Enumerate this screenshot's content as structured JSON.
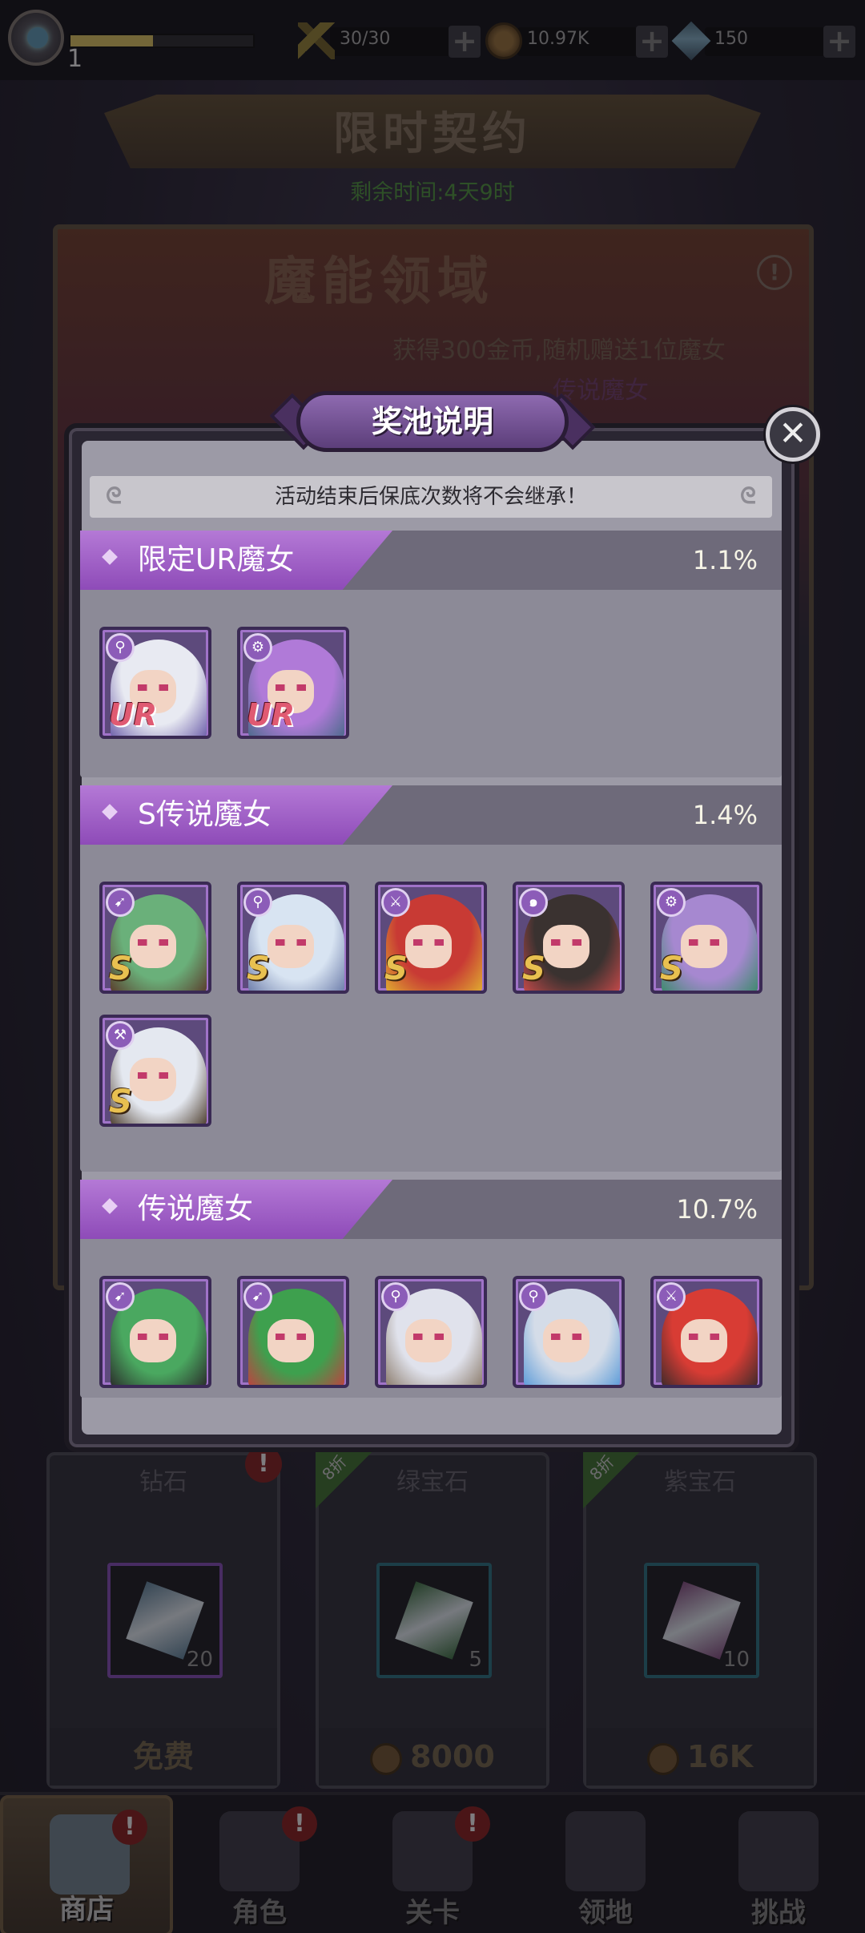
{
  "topbar": {
    "level": "1",
    "xp_fraction": 0.45,
    "stamina": "30/30",
    "gold": "10.97K",
    "diamonds": "150",
    "plus_symbol": "+"
  },
  "event": {
    "banner_title": "限时契约",
    "timer": "剩余时间:4天9时",
    "name": "魔能领域",
    "info_symbol": "!",
    "desc_line1": "获得300金币,随机赠送1位魔女",
    "desc_line2": "传说魔女"
  },
  "modal": {
    "title": "奖池说明",
    "close_symbol": "✕",
    "notice": "活动结束后保底次数将不会继承！",
    "swirl_symbol": "ᘓ",
    "sections": [
      {
        "title": "限定UR魔女",
        "rate": "1.1%",
        "characters": [
          {
            "rank": "UR",
            "class_icon": "staff-icon",
            "hair": "#e8eaf2",
            "accent": "#6a5ca8"
          },
          {
            "rank": "UR",
            "class_icon": "gear-icon",
            "hair": "#b07ad8",
            "accent": "#4a6a8a"
          }
        ]
      },
      {
        "title": "S传说魔女",
        "rate": "1.4%",
        "characters": [
          {
            "rank": "S",
            "class_icon": "gun-icon",
            "hair": "#6ab07a",
            "accent": "#5a3a2a"
          },
          {
            "rank": "S",
            "class_icon": "staff-icon",
            "hair": "#d8e4f2",
            "accent": "#6a7aa8"
          },
          {
            "rank": "S",
            "class_icon": "sword-icon",
            "hair": "#c83a34",
            "accent": "#e0b030"
          },
          {
            "rank": "S",
            "class_icon": "swirl-icon",
            "hair": "#3a3230",
            "accent": "#c84a4a"
          },
          {
            "rank": "S",
            "class_icon": "gear-icon",
            "hair": "#a688d0",
            "accent": "#3a8a6a"
          },
          {
            "rank": "S",
            "class_icon": "wrench-icon",
            "hair": "#e4e8f0",
            "accent": "#4a3a2a"
          }
        ]
      },
      {
        "title": "传说魔女",
        "rate": "10.7%",
        "characters": [
          {
            "rank": "",
            "class_icon": "gun-icon",
            "hair": "#4aa860",
            "accent": "#2a2a2a"
          },
          {
            "rank": "",
            "class_icon": "gun-icon",
            "hair": "#3ea04e",
            "accent": "#c04040"
          },
          {
            "rank": "",
            "class_icon": "staff-icon",
            "hair": "#e0e2ec",
            "accent": "#8a7a6a"
          },
          {
            "rank": "",
            "class_icon": "staff-icon",
            "hair": "#d4dce8",
            "accent": "#5a9ad8"
          },
          {
            "rank": "",
            "class_icon": "sword-icon",
            "hair": "#d83c34",
            "accent": "#3a2a2a"
          }
        ]
      }
    ]
  },
  "shop": {
    "cards": [
      {
        "name": "钻石",
        "count": "20",
        "price": "免费",
        "discount": "",
        "badge": "!",
        "gem_color": "#5a7a90",
        "slot_border": "#7a4aa8"
      },
      {
        "name": "绿宝石",
        "count": "5",
        "price": "8000",
        "discount": "8折",
        "badge": "",
        "gem_color": "#3a6a40",
        "slot_border": "#2a6a78"
      },
      {
        "name": "紫宝石",
        "count": "10",
        "price": "16K",
        "discount": "8折",
        "badge": "",
        "gem_color": "#7a4a78",
        "slot_border": "#2a6a78"
      }
    ]
  },
  "nav": {
    "items": [
      {
        "label": "商店",
        "alert": "!"
      },
      {
        "label": "角色",
        "alert": "!"
      },
      {
        "label": "关卡",
        "alert": "!"
      },
      {
        "label": "领地",
        "alert": ""
      },
      {
        "label": "挑战",
        "alert": ""
      }
    ]
  },
  "colors": {
    "accent_purple": "#9a5cc4",
    "panel_gray": "#9c9aa6"
  }
}
